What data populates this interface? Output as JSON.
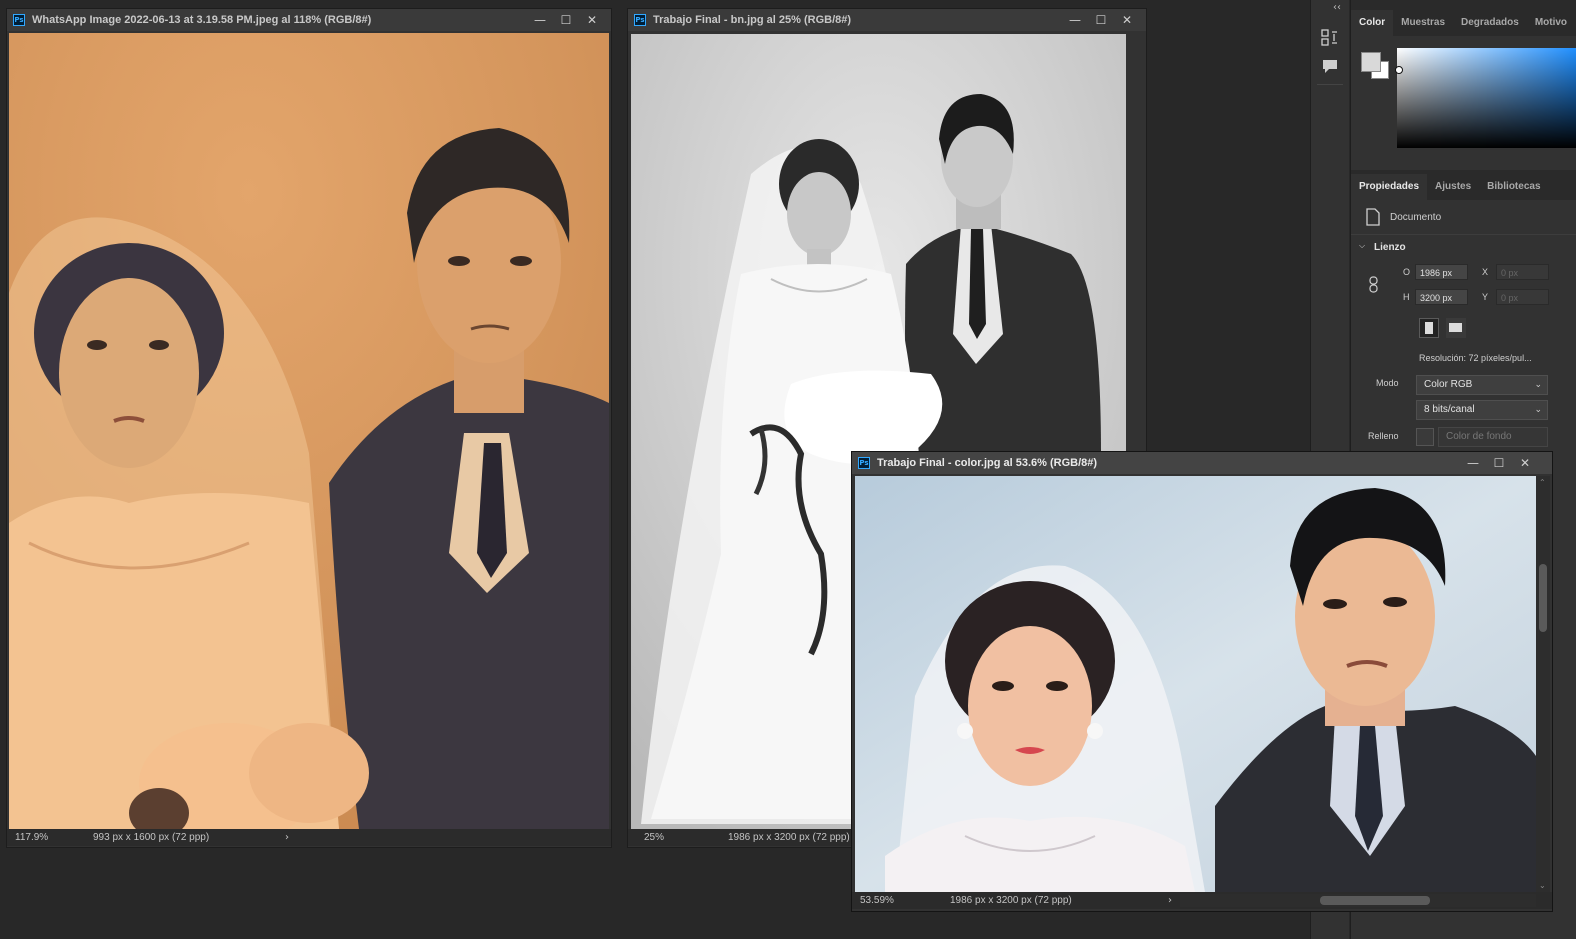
{
  "windows": {
    "original": {
      "title": "WhatsApp Image 2022-06-13 at 3.19.58 PM.jpeg al 118% (RGB/8#)",
      "zoom": "117.9%",
      "doc_info": "993 px x 1600 px (72 ppp)",
      "ps_icon": "Ps"
    },
    "bw": {
      "title": "Trabajo Final - bn.jpg al 25% (RGB/8#)",
      "zoom": "25%",
      "doc_info": "1986 px x 3200 px (72 ppp)",
      "ps_icon": "Ps"
    },
    "color": {
      "title": "Trabajo Final - color.jpg al 53.6% (RGB/8#)",
      "zoom": "53.59%",
      "doc_info": "1986 px x 3200 px (72 ppp)",
      "ps_icon": "Ps"
    }
  },
  "window_controls": {
    "minimize": "—",
    "maximize": "☐",
    "close": "✕"
  },
  "status_arrow": "›",
  "color_panel": {
    "tabs": [
      "Color",
      "Muestras",
      "Degradados",
      "Motivo"
    ],
    "collapse": "‹‹"
  },
  "properties_panel": {
    "tabs": [
      "Propiedades",
      "Ajustes",
      "Bibliotecas"
    ],
    "section_doc": "Documento",
    "canvas_section": "Lienzo",
    "width_label": "O",
    "width_value": "1986 px",
    "height_label": "H",
    "height_value": "3200 px",
    "x_label": "X",
    "x_value": "0 px",
    "y_label": "Y",
    "y_value": "0 px",
    "resolution": "Resolución: 72 píxeles/pul...",
    "mode_label": "Modo",
    "mode_value": "Color RGB",
    "depth_value": "8 bits/canal",
    "fill_label": "Relleno",
    "fill_value": "Color de fondo"
  },
  "colors": {
    "accent_blue": "#31a8ff",
    "panel_bg": "#323232",
    "workspace_bg": "#282828"
  }
}
